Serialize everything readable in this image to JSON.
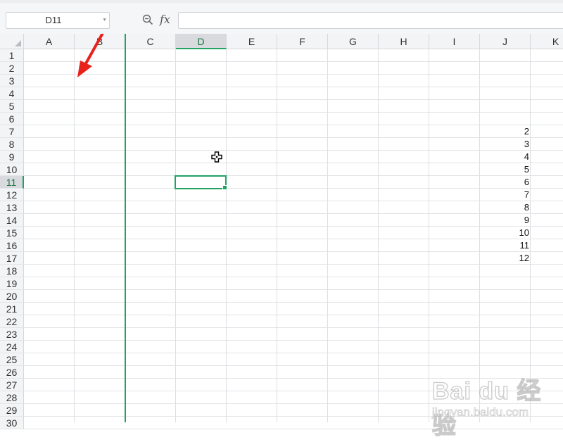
{
  "name_box": {
    "value": "D11"
  },
  "formula": {
    "fx_label": "fx",
    "value": ""
  },
  "columns": [
    "A",
    "B",
    "C",
    "D",
    "E",
    "F",
    "G",
    "H",
    "I",
    "J",
    "K"
  ],
  "active_column": "D",
  "rows": [
    "1",
    "2",
    "3",
    "4",
    "5",
    "6",
    "7",
    "8",
    "9",
    "10",
    "11",
    "12",
    "13",
    "14",
    "15",
    "16",
    "17",
    "18",
    "19",
    "20",
    "21",
    "22",
    "23",
    "24",
    "25",
    "26",
    "27",
    "28",
    "29",
    "30"
  ],
  "active_row": "11",
  "selected_cell": "D11",
  "column_J_values": [
    {
      "row": "7",
      "value": "2"
    },
    {
      "row": "8",
      "value": "3"
    },
    {
      "row": "9",
      "value": "4"
    },
    {
      "row": "10",
      "value": "5"
    },
    {
      "row": "11",
      "value": "6"
    },
    {
      "row": "12",
      "value": "7"
    },
    {
      "row": "13",
      "value": "8"
    },
    {
      "row": "14",
      "value": "9"
    },
    {
      "row": "15",
      "value": "10"
    },
    {
      "row": "16",
      "value": "11"
    },
    {
      "row": "17",
      "value": "12"
    }
  ],
  "accent_color": "#21a366",
  "annotation_color": "#e8211d",
  "watermark": {
    "logo_text": "Bai du 经验",
    "url_text": "jingyan.baidu.com"
  }
}
